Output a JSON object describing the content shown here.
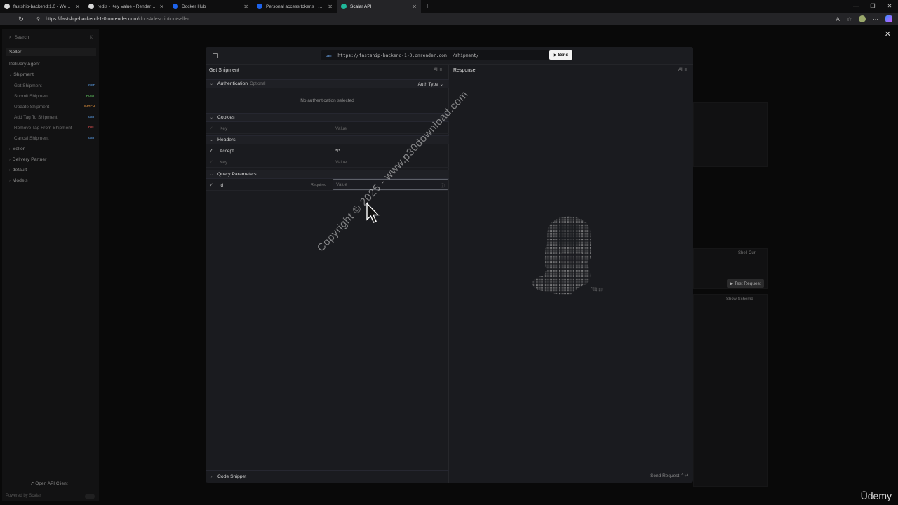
{
  "browser": {
    "tabs": [
      {
        "title": "fastship-backend:1.0 - Web Serv...",
        "active": false
      },
      {
        "title": "redis - Key Value - Render Dashb...",
        "active": false
      },
      {
        "title": "Docker Hub",
        "active": false
      },
      {
        "title": "Personal access tokens | Docker",
        "active": false
      },
      {
        "title": "Scalar API",
        "active": true
      }
    ],
    "url_host": "https://fastship-backend-1-0.onrender.com",
    "url_path": "/docs#description/seller"
  },
  "sidebar": {
    "search_placeholder": "Search",
    "search_shortcut": "⌃K",
    "items": [
      {
        "label": "Seller"
      },
      {
        "label": "Delivery Agent"
      },
      {
        "label": "Shipment"
      }
    ],
    "sub_items": [
      {
        "label": "Get Shipment",
        "method": "GET"
      },
      {
        "label": "Submit Shipment",
        "method": "POST"
      },
      {
        "label": "Update Shipment",
        "method": "PATCH"
      },
      {
        "label": "Add Tag To Shipment",
        "method": "GET"
      },
      {
        "label": "Remove Tag From Shipment",
        "method": "DEL"
      },
      {
        "label": "Cancel Shipment",
        "method": "GET"
      }
    ],
    "groups": [
      {
        "label": "Seller"
      },
      {
        "label": "Delivery Partner"
      },
      {
        "label": "default"
      },
      {
        "label": "Models"
      }
    ],
    "open_client": "Open API Client",
    "powered_by": "Powered by Scalar"
  },
  "background": {
    "shell_curl": "Shell Curl",
    "test_request": "Test Request",
    "show_schema": "Show Schema"
  },
  "modal": {
    "method": "GET",
    "host": "https://fastship-backend-1-0.onrender.com",
    "path": "/shipment/",
    "send": "Send",
    "left_title": "Get Shipment",
    "all": "All",
    "auth": {
      "title": "Authentication",
      "optional": "Optional",
      "type_label": "Auth Type",
      "empty": "No authentication selected"
    },
    "cookies": {
      "title": "Cookies",
      "key": "Key",
      "value": "Value"
    },
    "headers": {
      "title": "Headers",
      "rows": [
        {
          "key": "Accept",
          "value": "*/*"
        }
      ],
      "key": "Key",
      "value": "Value"
    },
    "query": {
      "title": "Query Parameters",
      "param": "id",
      "required": "Required",
      "value_placeholder": "Value"
    },
    "code_snippet": "Code Snippet",
    "response_title": "Response",
    "send_request": "Send Request",
    "send_shortcut": "⌃↵"
  },
  "watermark": "Copyright © 2025 - www.p30download.com",
  "brand": "Ūdemy"
}
